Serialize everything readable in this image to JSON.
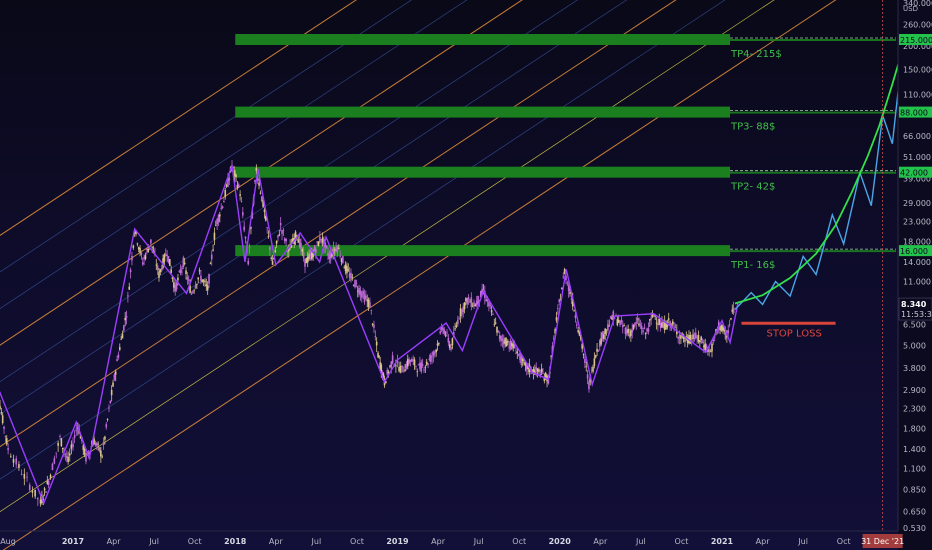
{
  "chart_data": {
    "type": "line",
    "title": "",
    "xlabel": "",
    "ylabel": "",
    "scale": "log",
    "currency": "USD",
    "grid": false,
    "y_ticks": [
      "340.000",
      "260.000",
      "200.000",
      "150.000",
      "110.000",
      "86.000",
      "66.000",
      "51.000",
      "39.000",
      "29.000",
      "23.000",
      "18.000",
      "14.000",
      "11.000",
      "8.340",
      "6.500",
      "5.000",
      "3.800",
      "2.900",
      "2.300",
      "1.800",
      "1.400",
      "1.100",
      "0.850",
      "0.650",
      "0.530"
    ],
    "x_ticks": [
      {
        "label": "Aug",
        "t": 2016.58,
        "year": false
      },
      {
        "label": "2017",
        "t": 2017.0,
        "year": true
      },
      {
        "label": "Apr",
        "t": 2017.25,
        "year": false
      },
      {
        "label": "Jul",
        "t": 2017.5,
        "year": false
      },
      {
        "label": "Oct",
        "t": 2017.75,
        "year": false
      },
      {
        "label": "2018",
        "t": 2018.0,
        "year": true
      },
      {
        "label": "Apr",
        "t": 2018.25,
        "year": false
      },
      {
        "label": "Jul",
        "t": 2018.5,
        "year": false
      },
      {
        "label": "Oct",
        "t": 2018.75,
        "year": false
      },
      {
        "label": "2019",
        "t": 2019.0,
        "year": true
      },
      {
        "label": "Apr",
        "t": 2019.25,
        "year": false
      },
      {
        "label": "Jul",
        "t": 2019.5,
        "year": false
      },
      {
        "label": "Oct",
        "t": 2019.75,
        "year": false
      },
      {
        "label": "2020",
        "t": 2020.0,
        "year": true
      },
      {
        "label": "Apr",
        "t": 2020.25,
        "year": false
      },
      {
        "label": "Jul",
        "t": 2020.5,
        "year": false
      },
      {
        "label": "Oct",
        "t": 2020.75,
        "year": false
      },
      {
        "label": "2021",
        "t": 2021.0,
        "year": true
      },
      {
        "label": "Apr",
        "t": 2021.25,
        "year": false
      },
      {
        "label": "Jul",
        "t": 2021.5,
        "year": false
      },
      {
        "label": "Oct",
        "t": 2021.75,
        "year": false
      }
    ],
    "price_series": {
      "name": "",
      "points": [
        [
          2016.5,
          3.6
        ],
        [
          2016.55,
          2.4
        ],
        [
          2016.6,
          1.4
        ],
        [
          2016.7,
          1.0
        ],
        [
          2016.8,
          0.72
        ],
        [
          2016.85,
          0.95
        ],
        [
          2016.92,
          1.6
        ],
        [
          2016.97,
          1.2
        ],
        [
          2017.03,
          1.9
        ],
        [
          2017.08,
          1.25
        ],
        [
          2017.13,
          1.55
        ],
        [
          2017.18,
          1.3
        ],
        [
          2017.23,
          2.5
        ],
        [
          2017.28,
          4.5
        ],
        [
          2017.33,
          7.5
        ],
        [
          2017.38,
          21
        ],
        [
          2017.43,
          14
        ],
        [
          2017.48,
          18
        ],
        [
          2017.53,
          12
        ],
        [
          2017.58,
          16
        ],
        [
          2017.63,
          10
        ],
        [
          2017.68,
          14
        ],
        [
          2017.73,
          9.5
        ],
        [
          2017.78,
          12
        ],
        [
          2017.83,
          10
        ],
        [
          2017.88,
          22
        ],
        [
          2017.93,
          30
        ],
        [
          2017.98,
          46
        ],
        [
          2018.03,
          33
        ],
        [
          2018.08,
          14
        ],
        [
          2018.13,
          44
        ],
        [
          2018.18,
          26
        ],
        [
          2018.23,
          13.5
        ],
        [
          2018.28,
          22
        ],
        [
          2018.33,
          16
        ],
        [
          2018.38,
          20
        ],
        [
          2018.43,
          14
        ],
        [
          2018.48,
          15.5
        ],
        [
          2018.53,
          19
        ],
        [
          2018.58,
          15
        ],
        [
          2018.63,
          17
        ],
        [
          2018.68,
          13
        ],
        [
          2018.73,
          11
        ],
        [
          2018.78,
          9.5
        ],
        [
          2018.83,
          8.3
        ],
        [
          2018.88,
          4.5
        ],
        [
          2018.92,
          3.2
        ],
        [
          2018.97,
          4.2
        ],
        [
          2019.03,
          3.7
        ],
        [
          2019.08,
          4.2
        ],
        [
          2019.13,
          3.8
        ],
        [
          2019.18,
          4.0
        ],
        [
          2019.23,
          4.6
        ],
        [
          2019.28,
          6.3
        ],
        [
          2019.33,
          4.9
        ],
        [
          2019.38,
          7.3
        ],
        [
          2019.43,
          8.8
        ],
        [
          2019.48,
          8.3
        ],
        [
          2019.53,
          9.8
        ],
        [
          2019.58,
          7.5
        ],
        [
          2019.63,
          5.5
        ],
        [
          2019.68,
          5.2
        ],
        [
          2019.73,
          4.8
        ],
        [
          2019.78,
          3.9
        ],
        [
          2019.83,
          3.7
        ],
        [
          2019.88,
          3.6
        ],
        [
          2019.93,
          3.3
        ],
        [
          2019.98,
          6.8
        ],
        [
          2020.03,
          12.5
        ],
        [
          2020.08,
          8.5
        ],
        [
          2020.13,
          5.4
        ],
        [
          2020.18,
          3.1
        ],
        [
          2020.23,
          4.8
        ],
        [
          2020.28,
          6.0
        ],
        [
          2020.33,
          7.2
        ],
        [
          2020.38,
          6.5
        ],
        [
          2020.43,
          5.8
        ],
        [
          2020.48,
          6.7
        ],
        [
          2020.53,
          5.8
        ],
        [
          2020.58,
          7.4
        ],
        [
          2020.63,
          6.3
        ],
        [
          2020.68,
          6.7
        ],
        [
          2020.73,
          5.8
        ],
        [
          2020.78,
          5.3
        ],
        [
          2020.83,
          5.6
        ],
        [
          2020.88,
          5.2
        ],
        [
          2020.93,
          4.6
        ],
        [
          2020.98,
          6.5
        ],
        [
          2021.03,
          5.6
        ],
        [
          2021.08,
          8.5
        ]
      ]
    },
    "pattern_zigzag": {
      "color": "#9b3dff",
      "points": [
        [
          2016.5,
          3.6
        ],
        [
          2016.82,
          0.72
        ],
        [
          2017.02,
          1.95
        ],
        [
          2017.1,
          1.25
        ],
        [
          2017.38,
          21
        ],
        [
          2017.7,
          9.5
        ],
        [
          2017.98,
          46
        ],
        [
          2018.06,
          14
        ],
        [
          2018.14,
          44
        ],
        [
          2018.25,
          13.5
        ],
        [
          2018.4,
          20
        ],
        [
          2018.52,
          14
        ],
        [
          2018.56,
          19
        ],
        [
          2018.92,
          3.2
        ],
        [
          2019.0,
          4.2
        ],
        [
          2019.3,
          6.6
        ],
        [
          2019.4,
          4.7
        ],
        [
          2019.53,
          9.8
        ],
        [
          2019.83,
          3.6
        ],
        [
          2019.93,
          3.3
        ],
        [
          2020.04,
          12.8
        ],
        [
          2020.2,
          3.1
        ],
        [
          2020.34,
          7.2
        ],
        [
          2020.58,
          7.4
        ],
        [
          2020.9,
          4.6
        ],
        [
          2021.0,
          6.8
        ],
        [
          2021.05,
          5.2
        ],
        [
          2021.1,
          8.6
        ]
      ]
    },
    "projection_zigzag": {
      "color": "#4aa6e8",
      "points": [
        [
          2021.08,
          7.8
        ],
        [
          2021.18,
          9.6
        ],
        [
          2021.25,
          8.3
        ],
        [
          2021.33,
          11.0
        ],
        [
          2021.42,
          9.2
        ],
        [
          2021.5,
          15.0
        ],
        [
          2021.58,
          12.0
        ],
        [
          2021.68,
          25.0
        ],
        [
          2021.75,
          17.5
        ],
        [
          2021.85,
          42.0
        ],
        [
          2021.92,
          28.0
        ],
        [
          2021.99,
          85.0
        ],
        [
          2022.05,
          60.0
        ],
        [
          2022.12,
          215.0
        ]
      ]
    },
    "projection_curve": {
      "color": "#34e04a",
      "points": [
        [
          2021.08,
          8.4
        ],
        [
          2021.25,
          9.3
        ],
        [
          2021.42,
          11.5
        ],
        [
          2021.58,
          15.5
        ],
        [
          2021.7,
          22
        ],
        [
          2021.8,
          33
        ],
        [
          2021.9,
          52
        ],
        [
          2021.97,
          75
        ],
        [
          2022.05,
          125
        ],
        [
          2022.1,
          175
        ],
        [
          2022.13,
          215
        ]
      ]
    },
    "targets": [
      {
        "label": "TP1- 16$",
        "price": 16.0,
        "price_tag": "16.000"
      },
      {
        "label": "TP2- 42$",
        "price": 42.0,
        "price_tag": "42.000"
      },
      {
        "label": "TP3- 88$",
        "price": 88.0,
        "price_tag": "88.000"
      },
      {
        "label": "TP4- 215$",
        "price": 215.0,
        "price_tag": "215.000"
      }
    ],
    "stop_loss": {
      "label": "STOP LOSS",
      "price": 6.5,
      "t_start": 2021.12,
      "t_end": 2021.7
    },
    "last_price": {
      "value": "8.340",
      "countdown": "11:53:32"
    },
    "cursor_date": "31 Dec '21",
    "regression_channel": {
      "slope_per_year": 1.32,
      "lines": [
        {
          "log_offset": 2.9,
          "color": "#e8913a"
        },
        {
          "log_offset": 2.45,
          "color": "#4a6fd1"
        },
        {
          "log_offset": 2.0,
          "color": "#4a6fd1"
        },
        {
          "log_offset": 1.55,
          "color": "#e8913a"
        },
        {
          "log_offset": 1.1,
          "color": "#4a6fd1"
        },
        {
          "log_offset": 0.7,
          "color": "#4a6fd1"
        },
        {
          "log_offset": 0.3,
          "color": "#e8913a"
        },
        {
          "log_offset": -0.1,
          "color": "#4a6fd1"
        },
        {
          "log_offset": -0.5,
          "color": "#e0d84a"
        },
        {
          "log_offset": -1.0,
          "color": "#e8913a"
        }
      ]
    },
    "colors": {
      "tp_band": "#1b7e1f",
      "tp_tag": "#23c24a",
      "stop": "#d6443a",
      "price_up": "#d9c48a",
      "price_down": "#c06ad8",
      "cursor": "#c94b4b"
    }
  }
}
